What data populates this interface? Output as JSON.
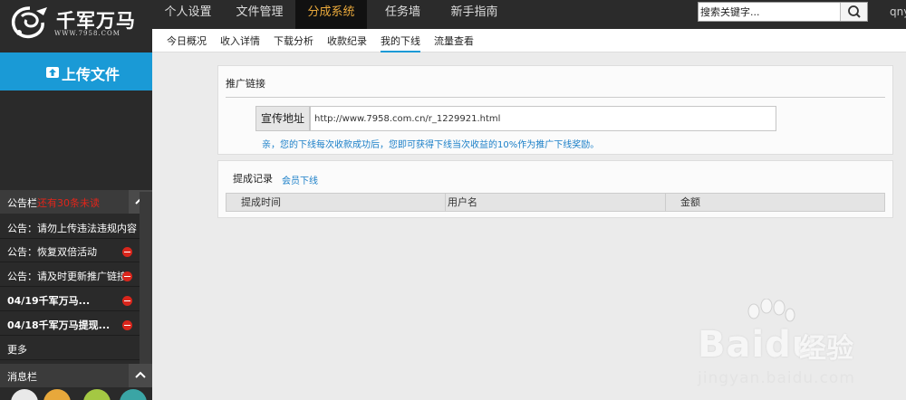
{
  "brand": {
    "name": "千军万马",
    "url": "WWW.7958.COM"
  },
  "top_nav": [
    {
      "label": "个人设置",
      "active": false
    },
    {
      "label": "文件管理",
      "active": false
    },
    {
      "label": "分成系统",
      "active": true
    },
    {
      "label": "任务墙",
      "active": false
    },
    {
      "label": "新手指南",
      "active": false
    }
  ],
  "search": {
    "placeholder": "搜索关键字..."
  },
  "user": {
    "name": "qny"
  },
  "sub_nav": [
    {
      "label": "今日概况",
      "active": false
    },
    {
      "label": "收入详情",
      "active": false
    },
    {
      "label": "下载分析",
      "active": false
    },
    {
      "label": "收款纪录",
      "active": false
    },
    {
      "label": "我的下线",
      "active": true
    },
    {
      "label": "流量查看",
      "active": false
    }
  ],
  "sidebar": {
    "upload_label": "上传文件",
    "notice_panel": {
      "title": "公告栏",
      "unread": "还有30条未读"
    },
    "notices": [
      {
        "text": "公告：请勿上传违法违规内容",
        "bold": false,
        "dot": false
      },
      {
        "text": "公告：恢复双倍活动",
        "bold": false,
        "dot": true
      },
      {
        "text": "公告：请及时更新推广链接",
        "bold": false,
        "dot": true
      },
      {
        "text": "04/19千军万马...",
        "bold": true,
        "dot": true
      },
      {
        "text": "04/18千军万马提现...",
        "bold": true,
        "dot": true
      }
    ],
    "more_label": "更多",
    "message_panel": {
      "title": "消息栏"
    }
  },
  "promo": {
    "title": "推广链接",
    "label": "宣传地址",
    "url": "http://www.7958.com.cn/r_1229921.html",
    "tip": "亲，您的下线每次收款成功后，您即可获得下线当次收益的10%作为推广下线奖励。"
  },
  "records": {
    "title": "提成记录",
    "link": "会员下线",
    "columns": [
      "提成时间",
      "用户名",
      "金额"
    ]
  },
  "watermark": {
    "brand": "Bai",
    "brand2": "du",
    "cn": "经验",
    "sub": "jingyan.baidu.com"
  },
  "colors": {
    "accent": "#1a9ad6",
    "active_tab_text": "#e8a83b",
    "alert_red": "#d9261c",
    "link_blue": "#1a7fc8"
  }
}
